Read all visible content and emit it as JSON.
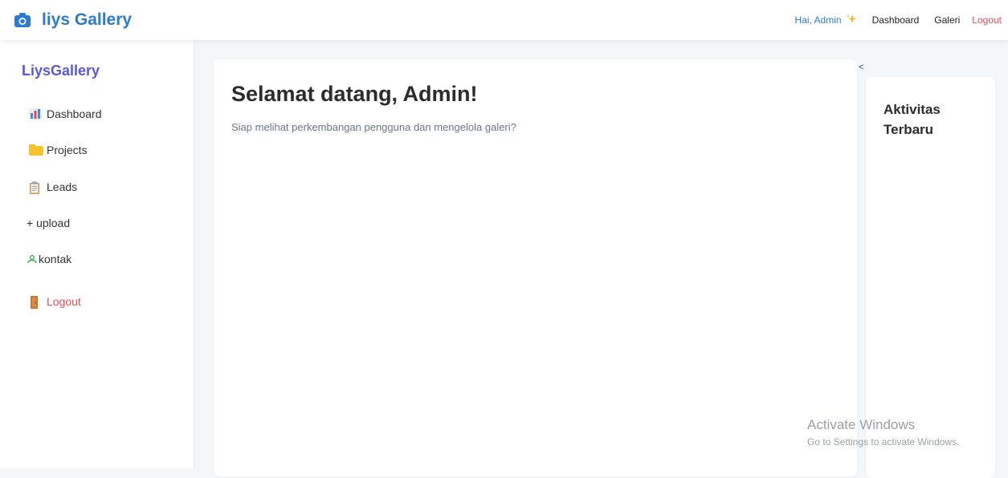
{
  "header": {
    "brand": "liys Gallery",
    "greeting": "Hai, Admin",
    "nav": {
      "dashboard": "Dashboard",
      "galeri": "Galeri",
      "logout": "Logout"
    }
  },
  "sidebar": {
    "title": "LiysGallery",
    "items": [
      {
        "label": "Dashboard",
        "icon": "bar-chart-icon"
      },
      {
        "label": "Projects",
        "icon": "folder-icon"
      },
      {
        "label": "Leads",
        "icon": "clipboard-icon"
      },
      {
        "label": "+ upload",
        "icon": ""
      },
      {
        "label": "kontak",
        "icon": "person-icon"
      },
      {
        "label": "Logout",
        "icon": "door-icon"
      }
    ]
  },
  "main": {
    "heading": "Selamat datang, Admin!",
    "subtitle": "Siap melihat perkembangan pengguna dan mengelola galeri?"
  },
  "toggle": "<",
  "activity": {
    "title": "Aktivitas Terbaru"
  },
  "watermark": {
    "line1": "Activate Windows",
    "line2": "Go to Settings to activate Windows."
  },
  "colors": {
    "brand": "#2b7bd3",
    "sidebar_title": "#5b58d6",
    "logout": "#e44d5b",
    "muted": "#6a7588"
  }
}
